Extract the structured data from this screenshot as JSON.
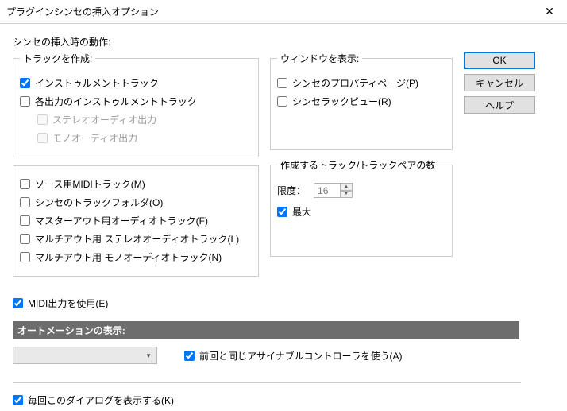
{
  "window": {
    "title": "プラグインシンセの挿入オプション"
  },
  "buttons": {
    "ok": "OK",
    "cancel": "キャンセル",
    "help": "ヘルプ"
  },
  "main_label": "シンセの挿入時の動作:",
  "groups": {
    "create_tracks": {
      "legend": "トラックを作成:",
      "instrument_track": "インストゥルメントトラック",
      "per_output_instrument_track": "各出力のインストゥルメントトラック",
      "stereo_audio_out": "ステレオオーディオ出力",
      "mono_audio_out": "モノオーディオ出力"
    },
    "more_tracks": {
      "source_midi_track": "ソース用MIDIトラック(M)",
      "synth_track_folder": "シンセのトラックフォルダ(O)",
      "master_out_audio_track": "マスターアウト用オーディオトラック(F)",
      "multiout_stereo_audio_track": "マルチアウト用 ステレオオーディオトラック(L)",
      "multiout_mono_audio_track": "マルチアウト用 モノオーディオトラック(N)"
    },
    "show_window": {
      "legend": "ウィンドウを表示:",
      "synth_property_page": "シンセのプロパティページ(P)",
      "synth_rack_view": "シンセラックビュー(R)"
    },
    "pair_count": {
      "legend": "作成するトラック/トラックペアの数",
      "limit_label": "限度：",
      "limit_value": "16",
      "max": "最大"
    }
  },
  "midi_out": "MIDI出力を使用(E)",
  "automation": {
    "section_title": "オートメーションの表示:",
    "dropdown_value": "",
    "use_prev_assignable": "前回と同じアサイナブルコントローラを使う(A)"
  },
  "always_show": "毎回このダイアログを表示する(K)"
}
